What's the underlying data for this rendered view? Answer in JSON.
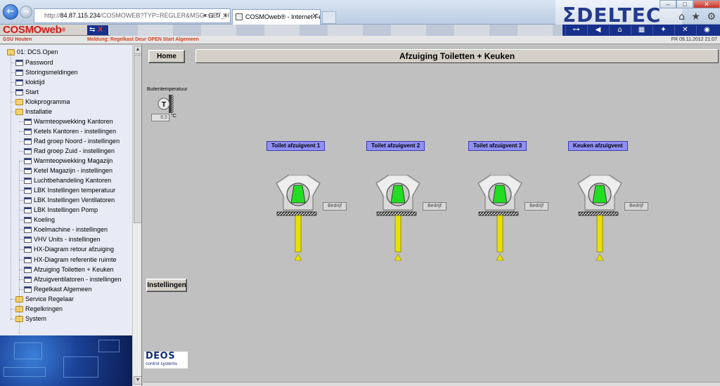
{
  "browser": {
    "address_prefix": "http://",
    "address_host": "84.87.115.234",
    "address_rest": "/COSMOWEB?TYP=REGLER&MSG=GET_HTM",
    "address_icons": "▾ ⊟ ↻ ✕",
    "tab_title": "COSMOweb® - Internet-Fe...",
    "tab_close": "✕",
    "banner_text": "ΣDELTEC",
    "window_controls": {
      "minimize": "–",
      "maximize": "□",
      "close": "✕"
    },
    "toolbar_icons": {
      "home": "⌂",
      "favorites": "★",
      "settings": "⚙"
    },
    "back_symbol": "←",
    "forward_symbol": "→"
  },
  "app": {
    "logo_main": "COSMOweb",
    "logo_sup": "®",
    "mini_icons_text": "⇆",
    "mini_icons_x": "X",
    "commands": [
      {
        "name": "logout-command-icon",
        "symbol": "⊶"
      },
      {
        "name": "back-command-icon",
        "symbol": "◀"
      },
      {
        "name": "home-command-icon",
        "symbol": "⌂"
      },
      {
        "name": "chart-command-icon",
        "symbol": "▦"
      },
      {
        "name": "tools-command-icon",
        "symbol": "✦"
      },
      {
        "name": "settings-command-icon",
        "symbol": "✕"
      },
      {
        "name": "help-command-icon",
        "symbol": "◉"
      }
    ]
  },
  "status": {
    "site": "GSU Houten",
    "message": "Meldung: Regelkast Deur OPEN Start Algemeen",
    "datetime": "FR 09.11.2012 21:07"
  },
  "tree": {
    "root": "01: DCS.Open",
    "items": [
      {
        "label": "Password",
        "type": "page",
        "level": 1
      },
      {
        "label": "Storingsmeldingen",
        "type": "page",
        "level": 1
      },
      {
        "label": "kloktijd",
        "type": "page",
        "level": 1
      },
      {
        "label": "Start",
        "type": "page",
        "level": 1
      },
      {
        "label": "Klokprogramma",
        "type": "folder",
        "level": 1
      },
      {
        "label": "Installatie",
        "type": "folder",
        "level": 1
      },
      {
        "label": "Warmteopwekking Kantoren",
        "type": "page",
        "level": 2
      },
      {
        "label": "Ketels Kantoren - instellingen",
        "type": "page",
        "level": 2
      },
      {
        "label": "Rad groep Noord - instellingen",
        "type": "page",
        "level": 2
      },
      {
        "label": "Rad groep Zuid - instellingen",
        "type": "page",
        "level": 2
      },
      {
        "label": "Warmteopwekking Magazijn",
        "type": "page",
        "level": 2
      },
      {
        "label": "Ketel Magazijn - instellingen",
        "type": "page",
        "level": 2
      },
      {
        "label": "Luchtbehandeling Kantoren",
        "type": "page",
        "level": 2
      },
      {
        "label": "LBK Instellingen temperatuur",
        "type": "page",
        "level": 2
      },
      {
        "label": "LBK Instellingen Ventilatoren",
        "type": "page",
        "level": 2
      },
      {
        "label": "LBK Instellingen Pomp",
        "type": "page",
        "level": 2
      },
      {
        "label": "Koeling",
        "type": "page",
        "level": 2
      },
      {
        "label": "Koelmachine - instellingen",
        "type": "page",
        "level": 2
      },
      {
        "label": "VHV Units - instellingen",
        "type": "page",
        "level": 2
      },
      {
        "label": "HX-Diagram retour afzuiging",
        "type": "page",
        "level": 2
      },
      {
        "label": "HX-Diagram referentie ruimte",
        "type": "page",
        "level": 2
      },
      {
        "label": "Afzuiging Toiletten + Keuken",
        "type": "page",
        "level": 2
      },
      {
        "label": "Afzuigventilatoren - instellingen",
        "type": "page",
        "level": 2
      },
      {
        "label": "Regelkast Algemeen",
        "type": "page",
        "level": 2
      },
      {
        "label": "Service Regelaar",
        "type": "folder",
        "level": 1
      },
      {
        "label": "Regelkringen",
        "type": "folder",
        "level": 1
      },
      {
        "label": "System",
        "type": "folder",
        "level": 1
      }
    ]
  },
  "control": {
    "home_label": "Home",
    "settings_label": "Instellingen",
    "outside_temp_label": "Buitentemperatuur",
    "sensor_letter": "T",
    "outside_temp_value": "8,5",
    "temp_unit": "°C",
    "deos_name": "DEOS",
    "deos_sub": "control systems"
  },
  "main": {
    "title": "Afzuiging Toiletten + Keuken",
    "fans": [
      {
        "label": "Toilet afzuigvent 1",
        "status": "Bedrijf",
        "running": true
      },
      {
        "label": "Toilet afzuigvent 2",
        "status": "Bedrijf",
        "running": true
      },
      {
        "label": "Toilet afzuigvent 3",
        "status": "Bedrijf",
        "running": true
      },
      {
        "label": "Keuken afzuigvent",
        "status": "Bedrijf",
        "running": true
      }
    ]
  },
  "colors": {
    "fan_running": "#22dd22",
    "label_bg": "#8f8ff5",
    "duct_yellow": "#e8e000",
    "brand_red": "#d21a1a",
    "brand_blue": "#17308c"
  }
}
